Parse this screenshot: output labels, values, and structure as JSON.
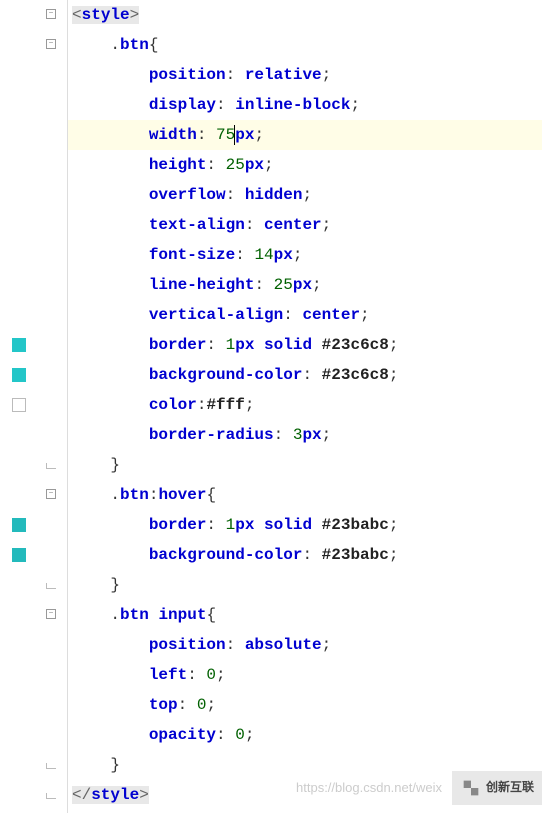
{
  "code_lines": [
    {
      "indent": 2,
      "tokens": [
        {
          "t": "<",
          "c": "angle",
          "hl": true
        },
        {
          "t": "style",
          "c": "tag",
          "hl": true
        },
        {
          "t": ">",
          "c": "angle",
          "hl": true
        }
      ],
      "fold": "open"
    },
    {
      "indent": 3,
      "tokens": [
        {
          "t": ".",
          "c": "punct"
        },
        {
          "t": "btn",
          "c": "sel"
        },
        {
          "t": "{",
          "c": "brace"
        }
      ],
      "fold": "open"
    },
    {
      "indent": 4,
      "tokens": [
        {
          "t": "position",
          "c": "prop"
        },
        {
          "t": ": ",
          "c": "colon"
        },
        {
          "t": "relative",
          "c": "kw"
        },
        {
          "t": ";",
          "c": "semi"
        }
      ]
    },
    {
      "indent": 4,
      "tokens": [
        {
          "t": "display",
          "c": "prop"
        },
        {
          "t": ": ",
          "c": "colon"
        },
        {
          "t": "inline-block",
          "c": "kw"
        },
        {
          "t": ";",
          "c": "semi"
        }
      ]
    },
    {
      "indent": 4,
      "tokens": [
        {
          "t": "width",
          "c": "prop"
        },
        {
          "t": ": ",
          "c": "colon"
        },
        {
          "t": "75",
          "c": "num"
        },
        {
          "t": "px",
          "c": "unit",
          "cursor": true
        },
        {
          "t": ";",
          "c": "semi"
        }
      ],
      "cursor_line": true
    },
    {
      "indent": 4,
      "tokens": [
        {
          "t": "height",
          "c": "prop"
        },
        {
          "t": ": ",
          "c": "colon"
        },
        {
          "t": "25",
          "c": "num"
        },
        {
          "t": "px",
          "c": "unit"
        },
        {
          "t": ";",
          "c": "semi"
        }
      ]
    },
    {
      "indent": 4,
      "tokens": [
        {
          "t": "overflow",
          "c": "prop"
        },
        {
          "t": ": ",
          "c": "colon"
        },
        {
          "t": "hidden",
          "c": "kw"
        },
        {
          "t": ";",
          "c": "semi"
        }
      ]
    },
    {
      "indent": 4,
      "tokens": [
        {
          "t": "text-align",
          "c": "prop"
        },
        {
          "t": ": ",
          "c": "colon"
        },
        {
          "t": "center",
          "c": "kw"
        },
        {
          "t": ";",
          "c": "semi"
        }
      ]
    },
    {
      "indent": 4,
      "tokens": [
        {
          "t": "font-size",
          "c": "prop"
        },
        {
          "t": ": ",
          "c": "colon"
        },
        {
          "t": "14",
          "c": "num"
        },
        {
          "t": "px",
          "c": "unit"
        },
        {
          "t": ";",
          "c": "semi"
        }
      ]
    },
    {
      "indent": 4,
      "tokens": [
        {
          "t": "line-height",
          "c": "prop"
        },
        {
          "t": ": ",
          "c": "colon"
        },
        {
          "t": "25",
          "c": "num"
        },
        {
          "t": "px",
          "c": "unit"
        },
        {
          "t": ";",
          "c": "semi"
        }
      ]
    },
    {
      "indent": 4,
      "tokens": [
        {
          "t": "vertical-align",
          "c": "prop"
        },
        {
          "t": ": ",
          "c": "colon"
        },
        {
          "t": "center",
          "c": "kw"
        },
        {
          "t": ";",
          "c": "semi"
        }
      ]
    },
    {
      "indent": 4,
      "tokens": [
        {
          "t": "border",
          "c": "prop"
        },
        {
          "t": ": ",
          "c": "colon"
        },
        {
          "t": "1",
          "c": "num"
        },
        {
          "t": "px",
          "c": "unit"
        },
        {
          "t": " ",
          "c": ""
        },
        {
          "t": "solid",
          "c": "kw"
        },
        {
          "t": " ",
          "c": ""
        },
        {
          "t": "#23c6c8",
          "c": "hex"
        },
        {
          "t": ";",
          "c": "semi"
        }
      ],
      "swatch": "swatch-fill"
    },
    {
      "indent": 4,
      "tokens": [
        {
          "t": "background-color",
          "c": "prop"
        },
        {
          "t": ": ",
          "c": "colon"
        },
        {
          "t": "#23c6c8",
          "c": "hex"
        },
        {
          "t": ";",
          "c": "semi"
        }
      ],
      "swatch": "swatch-fill"
    },
    {
      "indent": 4,
      "tokens": [
        {
          "t": "color",
          "c": "prop"
        },
        {
          "t": ":",
          "c": "colon"
        },
        {
          "t": "#fff",
          "c": "hex"
        },
        {
          "t": ";",
          "c": "semi"
        }
      ],
      "swatch": "swatch-outline"
    },
    {
      "indent": 4,
      "tokens": [
        {
          "t": "border-radius",
          "c": "prop"
        },
        {
          "t": ": ",
          "c": "colon"
        },
        {
          "t": "3",
          "c": "num"
        },
        {
          "t": "px",
          "c": "unit"
        },
        {
          "t": ";",
          "c": "semi"
        }
      ]
    },
    {
      "indent": 3,
      "tokens": [
        {
          "t": "}",
          "c": "brace"
        }
      ],
      "fold": "close"
    },
    {
      "indent": 3,
      "tokens": [
        {
          "t": ".",
          "c": "punct"
        },
        {
          "t": "btn",
          "c": "sel"
        },
        {
          "t": ":",
          "c": "punct"
        },
        {
          "t": "hover",
          "c": "pseudo"
        },
        {
          "t": "{",
          "c": "brace"
        }
      ],
      "fold": "open"
    },
    {
      "indent": 4,
      "tokens": [
        {
          "t": "border",
          "c": "prop"
        },
        {
          "t": ": ",
          "c": "colon"
        },
        {
          "t": "1",
          "c": "num"
        },
        {
          "t": "px",
          "c": "unit"
        },
        {
          "t": " ",
          "c": ""
        },
        {
          "t": "solid",
          "c": "kw"
        },
        {
          "t": " ",
          "c": ""
        },
        {
          "t": "#23babc",
          "c": "hex"
        },
        {
          "t": ";",
          "c": "semi"
        }
      ],
      "swatch": "swatch-fill2"
    },
    {
      "indent": 4,
      "tokens": [
        {
          "t": "background-color",
          "c": "prop"
        },
        {
          "t": ": ",
          "c": "colon"
        },
        {
          "t": "#23babc",
          "c": "hex"
        },
        {
          "t": ";",
          "c": "semi"
        }
      ],
      "swatch": "swatch-fill2"
    },
    {
      "indent": 3,
      "tokens": [
        {
          "t": "}",
          "c": "brace"
        }
      ],
      "fold": "close"
    },
    {
      "indent": 3,
      "tokens": [
        {
          "t": ".",
          "c": "punct"
        },
        {
          "t": "btn",
          "c": "sel"
        },
        {
          "t": " ",
          "c": ""
        },
        {
          "t": "input",
          "c": "sel"
        },
        {
          "t": "{",
          "c": "brace"
        }
      ],
      "fold": "open"
    },
    {
      "indent": 4,
      "tokens": [
        {
          "t": "position",
          "c": "prop"
        },
        {
          "t": ": ",
          "c": "colon"
        },
        {
          "t": "absolute",
          "c": "kw"
        },
        {
          "t": ";",
          "c": "semi"
        }
      ]
    },
    {
      "indent": 4,
      "tokens": [
        {
          "t": "left",
          "c": "prop"
        },
        {
          "t": ": ",
          "c": "colon"
        },
        {
          "t": "0",
          "c": "num"
        },
        {
          "t": ";",
          "c": "semi"
        }
      ]
    },
    {
      "indent": 4,
      "tokens": [
        {
          "t": "top",
          "c": "prop"
        },
        {
          "t": ": ",
          "c": "colon"
        },
        {
          "t": "0",
          "c": "num"
        },
        {
          "t": ";",
          "c": "semi"
        }
      ]
    },
    {
      "indent": 4,
      "tokens": [
        {
          "t": "opacity",
          "c": "prop"
        },
        {
          "t": ": ",
          "c": "colon"
        },
        {
          "t": "0",
          "c": "num"
        },
        {
          "t": ";",
          "c": "semi"
        }
      ]
    },
    {
      "indent": 3,
      "tokens": [
        {
          "t": "}",
          "c": "brace"
        }
      ],
      "fold": "close"
    },
    {
      "indent": 2,
      "tokens": [
        {
          "t": "</",
          "c": "angle",
          "hl": true
        },
        {
          "t": "style",
          "c": "tag",
          "hl": true
        },
        {
          "t": ">",
          "c": "angle",
          "hl": true
        }
      ],
      "fold": "close"
    }
  ],
  "watermark": "https://blog.csdn.net/weix",
  "logo": {
    "cn": "创新互联"
  }
}
